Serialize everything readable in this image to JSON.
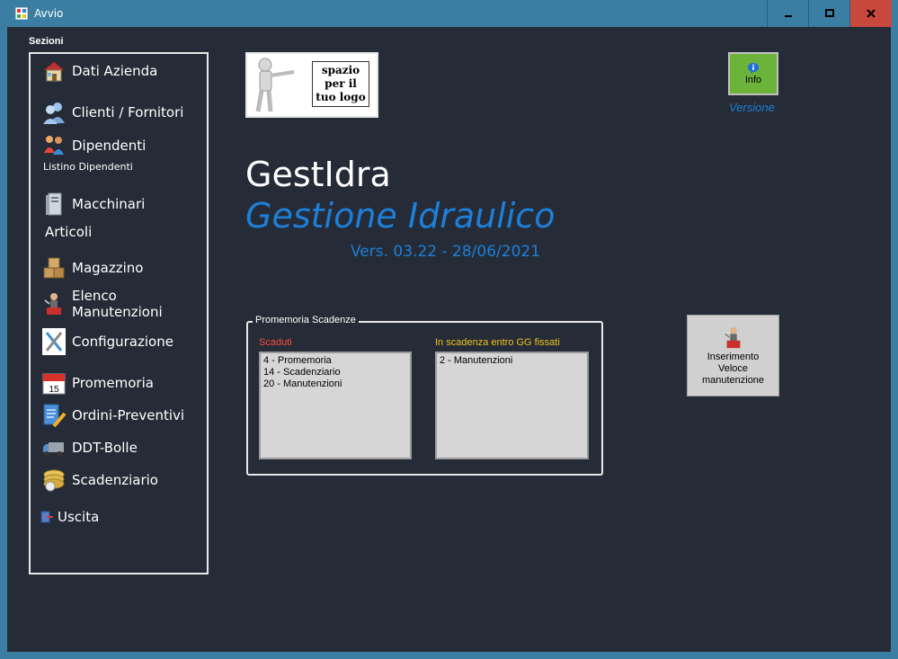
{
  "window": {
    "title": "Avvio",
    "min_label": "–",
    "max_label": "□",
    "close_label": "✕"
  },
  "sidebar": {
    "label": "Sezioni",
    "items": [
      {
        "label": "Dati Azienda",
        "icon": "house-icon"
      },
      {
        "label": "Clienti / Fornitori",
        "icon": "users-icon"
      },
      {
        "label": "Dipendenti",
        "icon": "people-icon"
      },
      {
        "label": "Listino Dipendenti",
        "icon": ""
      },
      {
        "label": "Macchinari",
        "icon": "server-icon"
      },
      {
        "label": "Articoli",
        "icon": ""
      },
      {
        "label": "Magazzino",
        "icon": "boxes-icon"
      },
      {
        "label": "Elenco Manutenzioni",
        "icon": "mechanic-icon"
      },
      {
        "label": "Configurazione",
        "icon": "tools-icon"
      },
      {
        "label": "Promemoria",
        "icon": "calendar-icon"
      },
      {
        "label": "Ordini-Preventivi",
        "icon": "document-pen-icon"
      },
      {
        "label": "DDT-Bolle",
        "icon": "truck-icon"
      },
      {
        "label": "Scadenziario",
        "icon": "coins-icon"
      },
      {
        "label": "Uscita",
        "icon": "exit-icon"
      }
    ]
  },
  "logo": {
    "line1": "spazio",
    "line2": "per il",
    "line3": "tuo logo"
  },
  "app": {
    "name": "GestIdra",
    "subtitle": "Gestione Idraulico",
    "version": "Vers. 03.22 - 28/06/2021"
  },
  "info": {
    "label": "Info",
    "link": "Versione",
    "accent": "#6bb33a"
  },
  "reminders": {
    "title": "Promemoria Scadenze",
    "expired_label": "Scaduti",
    "expired_color": "#ff4a3d",
    "expired_items": [
      "4 - Promemoria",
      "14 - Scadenziario",
      "20 - Manutenzioni"
    ],
    "upcoming_label": "In scadenza entro GG fissati",
    "upcoming_color": "#f0c21c",
    "upcoming_items": [
      "2 - Manutenzioni"
    ]
  },
  "quick": {
    "line1": "Inserimento",
    "line2": "Veloce",
    "line3": "manutenzione"
  },
  "colors": {
    "background": "#252c37",
    "titlebar": "#3a7fa3",
    "close": "#c8483c",
    "accent_blue": "#1e7fd8"
  }
}
